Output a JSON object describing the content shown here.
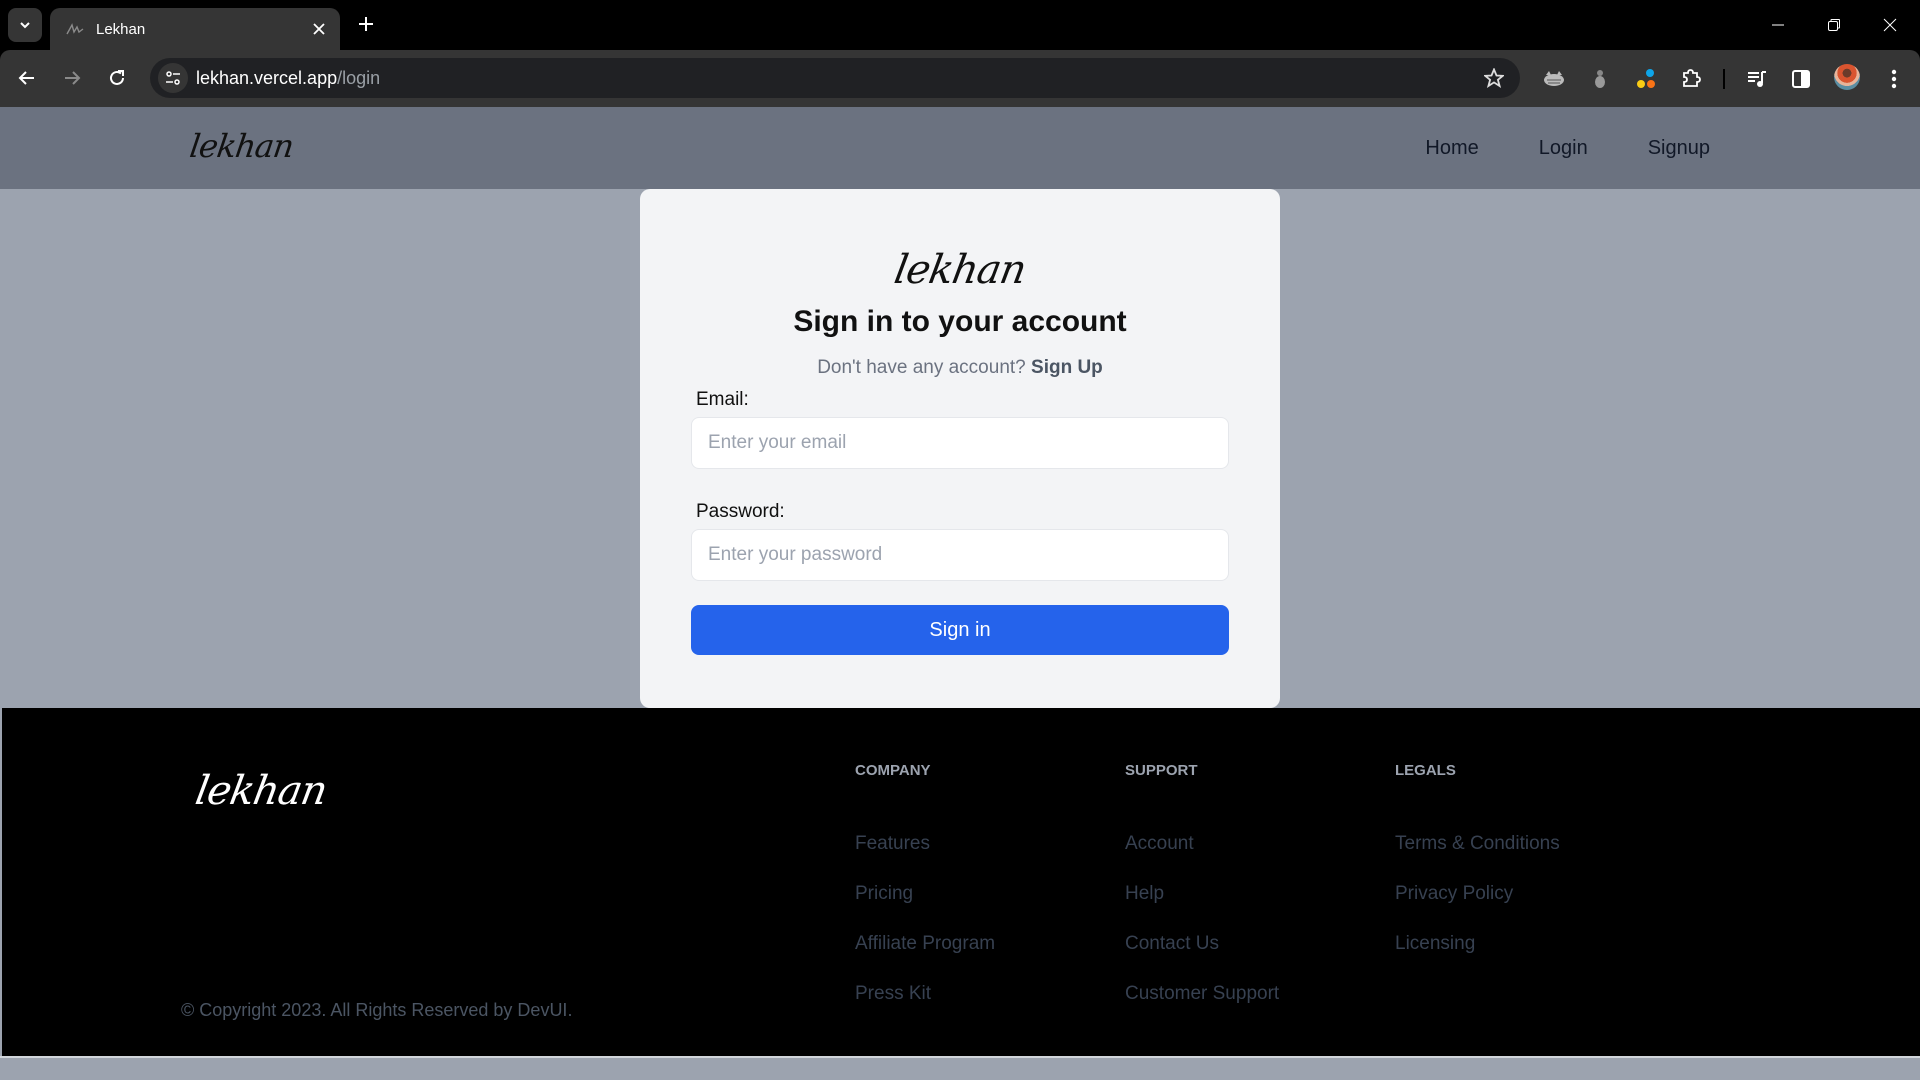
{
  "browser": {
    "tab_title": "Lekhan",
    "url_host": "lekhan.vercel.app",
    "url_path": "/login",
    "icons": {
      "tab_search": "chevron-down-icon",
      "tab_favicon": "lekhan-favicon",
      "tab_close": "close-icon",
      "new_tab": "plus-icon",
      "back": "arrow-left-icon",
      "forward": "arrow-right-icon",
      "reload": "reload-icon",
      "site_info": "tune-icon",
      "bookmark": "star-icon",
      "extensions": [
        "extension-cat-icon",
        "extension-bug-icon",
        "extension-dots-icon",
        "puzzle-icon"
      ],
      "media": "media-queue-icon",
      "side_panel": "side-panel-icon",
      "profile": "avatar",
      "menu": "kebab-menu-icon"
    }
  },
  "navbar": {
    "brand": "lekhan",
    "links": [
      {
        "label": "Home"
      },
      {
        "label": "Login"
      },
      {
        "label": "Signup"
      }
    ]
  },
  "login": {
    "brand": "lekhan",
    "title": "Sign in to your account",
    "subtitle": "Don't have any account?",
    "signup_link": "Sign Up",
    "email_label": "Email:",
    "email_placeholder": "Enter your email",
    "email_value": "",
    "password_label": "Password:",
    "password_placeholder": "Enter your password",
    "password_value": "",
    "submit_label": "Sign in",
    "accent_color": "#2563eb"
  },
  "footer": {
    "brand": "lekhan",
    "copyright": "© Copyright 2023. All Rights Reserved by DevUI.",
    "columns": [
      {
        "heading": "Company",
        "links": [
          "Features",
          "Pricing",
          "Affiliate Program",
          "Press Kit"
        ]
      },
      {
        "heading": "Support",
        "links": [
          "Account",
          "Help",
          "Contact Us",
          "Customer Support"
        ]
      },
      {
        "heading": "Legals",
        "links": [
          "Terms & Conditions",
          "Privacy Policy",
          "Licensing"
        ]
      }
    ]
  }
}
